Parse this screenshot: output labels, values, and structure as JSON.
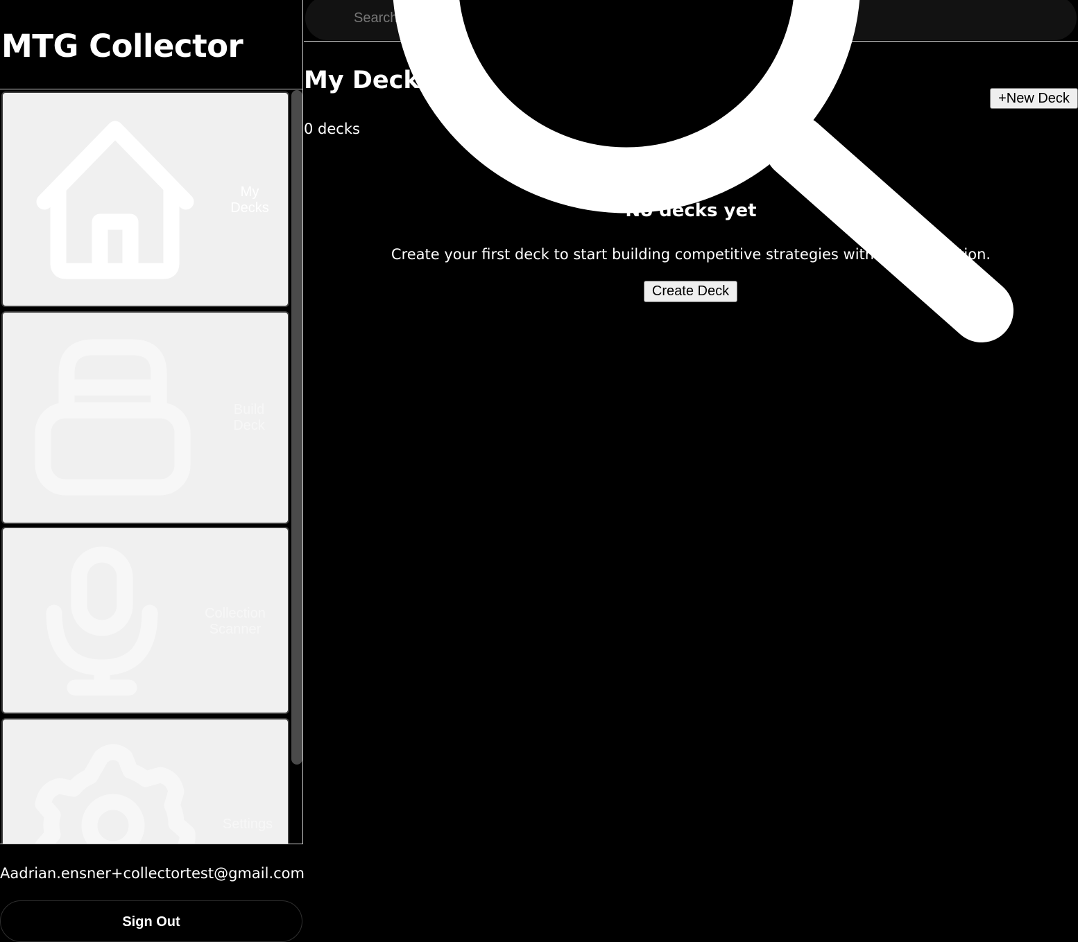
{
  "app": {
    "title": "MTG Collector"
  },
  "sidebar": {
    "items": [
      {
        "label_line1": "My",
        "label_line2": "Decks",
        "icon": "home-icon"
      },
      {
        "label_line1": "Build",
        "label_line2": "Deck",
        "icon": "bag-icon"
      },
      {
        "label_line1": "Collection",
        "label_line2": "Scanner",
        "icon": "microphone-icon"
      },
      {
        "label_line1": "Settings",
        "label_line2": "",
        "icon": "gear-icon"
      }
    ]
  },
  "account": {
    "email": "Aadrian.ensner+collectortest@gmail.com",
    "sign_out_label": "Sign Out"
  },
  "search": {
    "placeholder": "Search cards..."
  },
  "main": {
    "title": "My Decks",
    "new_deck_label": "+New Deck",
    "deck_count": "0 decks",
    "empty_state": {
      "title": "No decks yet",
      "text": "Create your first deck to start building competitive strategies with your collection.",
      "button_label": "Create Deck"
    }
  },
  "colors": {
    "background": "#000000",
    "nav_card": "#f0f0f0",
    "text": "#ffffff",
    "button_bg": "#efefef",
    "divider": "#d0d0d0"
  }
}
